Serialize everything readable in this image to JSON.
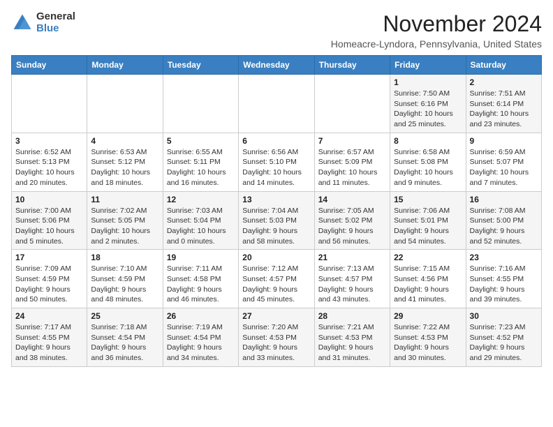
{
  "logo": {
    "general": "General",
    "blue": "Blue"
  },
  "header": {
    "month_year": "November 2024",
    "location": "Homeacre-Lyndora, Pennsylvania, United States"
  },
  "weekdays": [
    "Sunday",
    "Monday",
    "Tuesday",
    "Wednesday",
    "Thursday",
    "Friday",
    "Saturday"
  ],
  "weeks": [
    [
      {
        "day": "",
        "info": ""
      },
      {
        "day": "",
        "info": ""
      },
      {
        "day": "",
        "info": ""
      },
      {
        "day": "",
        "info": ""
      },
      {
        "day": "",
        "info": ""
      },
      {
        "day": "1",
        "info": "Sunrise: 7:50 AM\nSunset: 6:16 PM\nDaylight: 10 hours\nand 25 minutes."
      },
      {
        "day": "2",
        "info": "Sunrise: 7:51 AM\nSunset: 6:14 PM\nDaylight: 10 hours\nand 23 minutes."
      }
    ],
    [
      {
        "day": "3",
        "info": "Sunrise: 6:52 AM\nSunset: 5:13 PM\nDaylight: 10 hours\nand 20 minutes."
      },
      {
        "day": "4",
        "info": "Sunrise: 6:53 AM\nSunset: 5:12 PM\nDaylight: 10 hours\nand 18 minutes."
      },
      {
        "day": "5",
        "info": "Sunrise: 6:55 AM\nSunset: 5:11 PM\nDaylight: 10 hours\nand 16 minutes."
      },
      {
        "day": "6",
        "info": "Sunrise: 6:56 AM\nSunset: 5:10 PM\nDaylight: 10 hours\nand 14 minutes."
      },
      {
        "day": "7",
        "info": "Sunrise: 6:57 AM\nSunset: 5:09 PM\nDaylight: 10 hours\nand 11 minutes."
      },
      {
        "day": "8",
        "info": "Sunrise: 6:58 AM\nSunset: 5:08 PM\nDaylight: 10 hours\nand 9 minutes."
      },
      {
        "day": "9",
        "info": "Sunrise: 6:59 AM\nSunset: 5:07 PM\nDaylight: 10 hours\nand 7 minutes."
      }
    ],
    [
      {
        "day": "10",
        "info": "Sunrise: 7:00 AM\nSunset: 5:06 PM\nDaylight: 10 hours\nand 5 minutes."
      },
      {
        "day": "11",
        "info": "Sunrise: 7:02 AM\nSunset: 5:05 PM\nDaylight: 10 hours\nand 2 minutes."
      },
      {
        "day": "12",
        "info": "Sunrise: 7:03 AM\nSunset: 5:04 PM\nDaylight: 10 hours\nand 0 minutes."
      },
      {
        "day": "13",
        "info": "Sunrise: 7:04 AM\nSunset: 5:03 PM\nDaylight: 9 hours\nand 58 minutes."
      },
      {
        "day": "14",
        "info": "Sunrise: 7:05 AM\nSunset: 5:02 PM\nDaylight: 9 hours\nand 56 minutes."
      },
      {
        "day": "15",
        "info": "Sunrise: 7:06 AM\nSunset: 5:01 PM\nDaylight: 9 hours\nand 54 minutes."
      },
      {
        "day": "16",
        "info": "Sunrise: 7:08 AM\nSunset: 5:00 PM\nDaylight: 9 hours\nand 52 minutes."
      }
    ],
    [
      {
        "day": "17",
        "info": "Sunrise: 7:09 AM\nSunset: 4:59 PM\nDaylight: 9 hours\nand 50 minutes."
      },
      {
        "day": "18",
        "info": "Sunrise: 7:10 AM\nSunset: 4:59 PM\nDaylight: 9 hours\nand 48 minutes."
      },
      {
        "day": "19",
        "info": "Sunrise: 7:11 AM\nSunset: 4:58 PM\nDaylight: 9 hours\nand 46 minutes."
      },
      {
        "day": "20",
        "info": "Sunrise: 7:12 AM\nSunset: 4:57 PM\nDaylight: 9 hours\nand 45 minutes."
      },
      {
        "day": "21",
        "info": "Sunrise: 7:13 AM\nSunset: 4:57 PM\nDaylight: 9 hours\nand 43 minutes."
      },
      {
        "day": "22",
        "info": "Sunrise: 7:15 AM\nSunset: 4:56 PM\nDaylight: 9 hours\nand 41 minutes."
      },
      {
        "day": "23",
        "info": "Sunrise: 7:16 AM\nSunset: 4:55 PM\nDaylight: 9 hours\nand 39 minutes."
      }
    ],
    [
      {
        "day": "24",
        "info": "Sunrise: 7:17 AM\nSunset: 4:55 PM\nDaylight: 9 hours\nand 38 minutes."
      },
      {
        "day": "25",
        "info": "Sunrise: 7:18 AM\nSunset: 4:54 PM\nDaylight: 9 hours\nand 36 minutes."
      },
      {
        "day": "26",
        "info": "Sunrise: 7:19 AM\nSunset: 4:54 PM\nDaylight: 9 hours\nand 34 minutes."
      },
      {
        "day": "27",
        "info": "Sunrise: 7:20 AM\nSunset: 4:53 PM\nDaylight: 9 hours\nand 33 minutes."
      },
      {
        "day": "28",
        "info": "Sunrise: 7:21 AM\nSunset: 4:53 PM\nDaylight: 9 hours\nand 31 minutes."
      },
      {
        "day": "29",
        "info": "Sunrise: 7:22 AM\nSunset: 4:53 PM\nDaylight: 9 hours\nand 30 minutes."
      },
      {
        "day": "30",
        "info": "Sunrise: 7:23 AM\nSunset: 4:52 PM\nDaylight: 9 hours\nand 29 minutes."
      }
    ]
  ]
}
